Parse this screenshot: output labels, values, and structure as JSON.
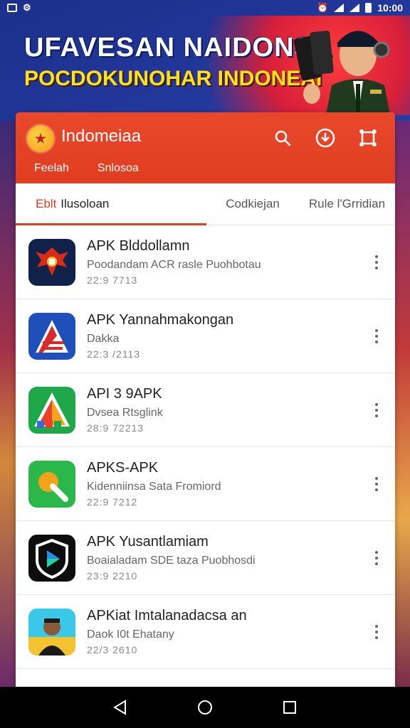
{
  "status_bar": {
    "time": "10:00"
  },
  "banner": {
    "line1": "UFAVESAN NAIDONSA",
    "line2": "POCDOKUNOHAR INDONEAI"
  },
  "app": {
    "title": "Indomeiaa",
    "subtabs": [
      "Feelah",
      "Snlosoa"
    ],
    "tabs": [
      {
        "prefix": "Eblt",
        "label": "Ilusoloan",
        "active": true
      },
      {
        "label": "Codkiejan",
        "active": false
      },
      {
        "label": "Rule l'Grridian",
        "active": false
      }
    ]
  },
  "list": [
    {
      "name": "APK Blddollamn",
      "desc": "Poodandam ACR rasle Puohbotau",
      "date": "22:9 7713",
      "icon": "garuda-icon"
    },
    {
      "name": "APK Yannahmakongan",
      "desc": "Dakka",
      "date": "22:3 /2113",
      "icon": "flag-a-icon"
    },
    {
      "name": "API 3 9APK",
      "desc": "Dvsea Rtsglink",
      "date": "28:9 72213",
      "icon": "tricolor-a-icon"
    },
    {
      "name": "APKS-APK",
      "desc": "Kidenniinsa Sata Fromiord",
      "date": "22:9 7212",
      "icon": "green-app-icon"
    },
    {
      "name": "APK Yusantlamiam",
      "desc": "Boaialadam SDE taza Puobhosdi",
      "date": "23:9 2210",
      "icon": "play-shield-icon"
    },
    {
      "name": "APKiat Imtalanadacsa an",
      "desc": "Daok I0t Ehatany",
      "date": "22/3 2610",
      "icon": "person-avatar-icon"
    }
  ],
  "colors": {
    "accent": "#e03d20",
    "appbar": "#e9492b",
    "banner_blue": "#2a3fa8",
    "banner_yellow": "#ffe21a"
  }
}
